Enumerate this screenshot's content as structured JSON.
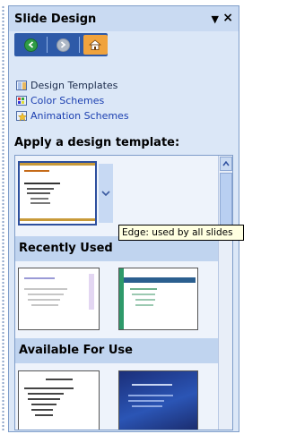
{
  "taskpane": {
    "title": "Slide Design",
    "dropdown_icon": "▼",
    "close_icon": "×"
  },
  "nav": {
    "back_icon": "back-arrow-icon",
    "forward_icon": "forward-arrow-icon",
    "home_icon": "home-icon"
  },
  "links": [
    {
      "label": "Design Templates"
    },
    {
      "label": "Color Schemes"
    },
    {
      "label": "Animation Schemes"
    }
  ],
  "apply_label": "Apply a design template:",
  "sections": {
    "recently_used": "Recently Used",
    "available": "Available For Use"
  },
  "tooltip": "Edge: used by all slides"
}
